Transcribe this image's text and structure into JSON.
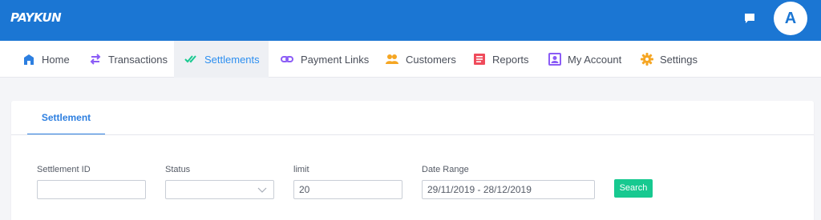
{
  "brand": {
    "logo_text": "PAYKUN",
    "accent": "#1b76d3"
  },
  "header": {
    "chat_icon": "chat-icon",
    "avatar_letter": "A"
  },
  "nav": {
    "items": [
      {
        "label": "Home",
        "icon": "home-icon",
        "color": "#2d7fe0"
      },
      {
        "label": "Transactions",
        "icon": "transfer-icon",
        "color": "#8b5cf6"
      },
      {
        "label": "Settlements",
        "icon": "double-check-icon",
        "color": "#17c990",
        "active": true
      },
      {
        "label": "Payment Links",
        "icon": "link-icon",
        "color": "#8b5cf6"
      },
      {
        "label": "Customers",
        "icon": "users-icon",
        "color": "#f5a623"
      },
      {
        "label": "Reports",
        "icon": "report-icon",
        "color": "#ef4b5b"
      },
      {
        "label": "My Account",
        "icon": "account-icon",
        "color": "#8b5cf6"
      },
      {
        "label": "Settings",
        "icon": "gear-icon",
        "color": "#f5a623"
      }
    ]
  },
  "settlement": {
    "tab_label": "Settlement",
    "filters": {
      "settlement_id": {
        "label": "Settlement ID",
        "value": ""
      },
      "status": {
        "label": "Status",
        "value": ""
      },
      "limit": {
        "label": "limit",
        "value": "20"
      },
      "date_range": {
        "label": "Date Range",
        "value": "29/11/2019 - 28/12/2019"
      }
    },
    "search_label": "Search"
  }
}
